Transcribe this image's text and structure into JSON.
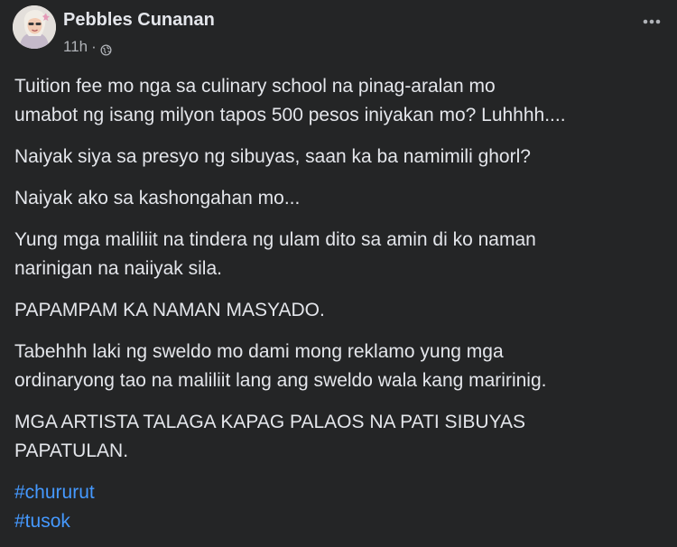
{
  "post": {
    "author": "Pebbles Cunanan",
    "timestamp": "11h",
    "separator": "·",
    "audience_icon": "globe-icon",
    "more_icon": "more-options-icon",
    "paragraphs": [
      "Tuition fee mo nga sa culinary school na pinag-aralan mo\numabot ng isang milyon tapos 500 pesos iniyakan mo? Luhhhh....",
      "Naiyak siya sa presyo ng sibuyas, saan ka ba namimili ghorl?",
      "Naiyak ako sa kashongahan mo...",
      "Yung mga maliliit na tindera ng ulam dito sa amin di ko naman\nnarinigan na naiiyak sila.",
      "PAPAMPAM KA NAMAN MASYADO.",
      "Tabehhh laki ng sweldo mo dami mong reklamo yung mga\nordinaryong tao na maliliit lang ang sweldo wala kang maririnig.",
      "MGA ARTISTA TALAGA KAPAG PALAOS NA PATI SIBUYAS\nPAPATULAN."
    ],
    "hashtags": [
      "#chururut",
      "#tusok"
    ]
  },
  "colors": {
    "background": "#242526",
    "text": "#e4e6eb",
    "secondary_text": "#b0b3b8",
    "link": "#4599ff"
  }
}
